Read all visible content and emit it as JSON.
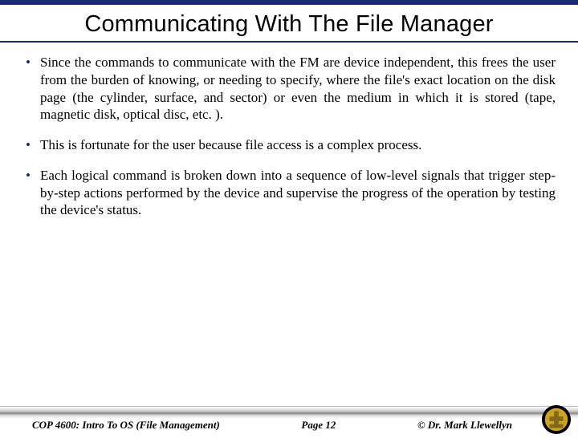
{
  "title": "Communicating With The File Manager",
  "bullets": [
    "Since the commands to communicate with the FM are device independent, this frees the user from the burden of knowing, or needing to specify, where the file's exact location on the disk page (the cylinder, surface, and sector) or even the medium in which it is stored (tape, magnetic disk, optical disc, etc. ).",
    "This is fortunate for the user because file access is a complex process.",
    "Each logical command is broken down into a sequence of low-level signals that trigger step-by-step actions performed by the device and supervise the progress of the operation by testing the device's status."
  ],
  "footer": {
    "left": "COP 4600: Intro To OS  (File Management)",
    "center": "Page 12",
    "right": "© Dr. Mark Llewellyn"
  }
}
